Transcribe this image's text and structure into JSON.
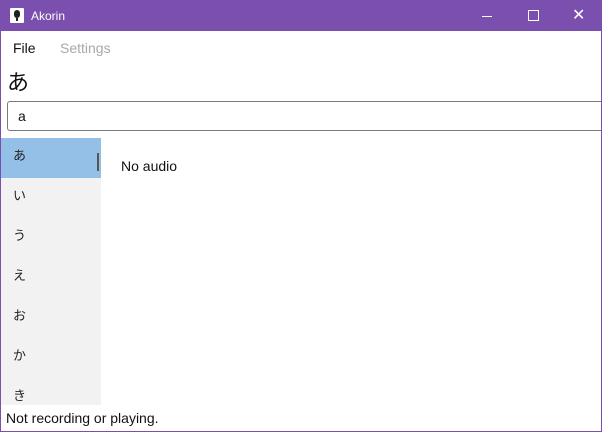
{
  "window": {
    "title": "Akorin",
    "accent": "#7a4fad",
    "icon": "microphone-icon"
  },
  "titlebar": {
    "minimize_glyph": "",
    "maximize_glyph": "",
    "close_glyph": "✕"
  },
  "menu": {
    "file": "File",
    "settings": "Settings"
  },
  "current_char": "あ",
  "search": {
    "value": "a",
    "placeholder": ""
  },
  "list": {
    "selected_index": 0,
    "selected_color": "#94c0e8",
    "items": [
      {
        "label": "あ"
      },
      {
        "label": "い"
      },
      {
        "label": "う"
      },
      {
        "label": "え"
      },
      {
        "label": "お"
      },
      {
        "label": "か"
      },
      {
        "label": "き"
      }
    ]
  },
  "main": {
    "message": "No audio"
  },
  "status": {
    "text": "Not recording or playing."
  }
}
